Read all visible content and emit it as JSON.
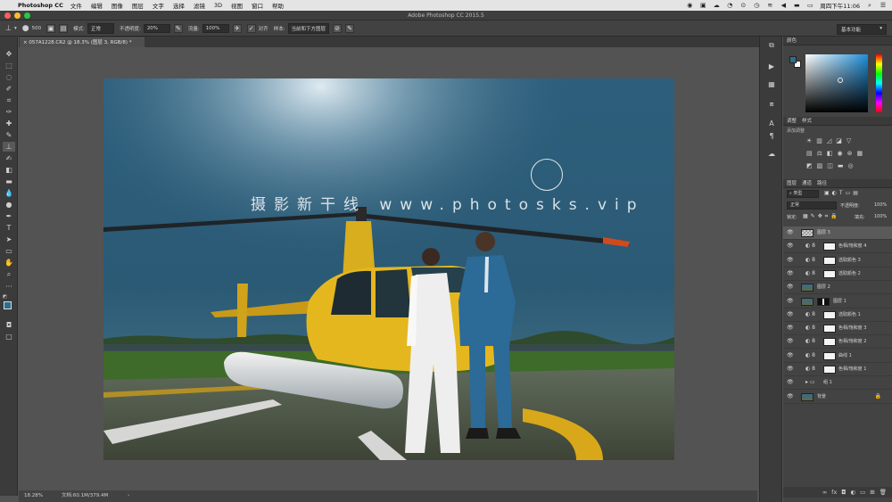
{
  "menubar": {
    "app": "Photoshop CC",
    "menus": [
      "文件",
      "编辑",
      "图像",
      "图层",
      "文字",
      "选择",
      "滤镜",
      "3D",
      "视图",
      "窗口",
      "帮助"
    ],
    "clock": "周四下午11:06"
  },
  "titlebar": {
    "title": "Adobe Photoshop CC 2015.5"
  },
  "options": {
    "brush_size": "500",
    "mode_label": "模式:",
    "mode_value": "正常",
    "opacity_label": "不透明度:",
    "opacity_value": "20%",
    "flow_label": "流量:",
    "flow_value": "100%",
    "aligned_label": "对齐",
    "sample_label": "样本:",
    "sample_value": "当前和下方图层",
    "workspace": "基本功能"
  },
  "document": {
    "tab_title": "057A1228.CR2 @ 18.3% (图层 3, RGB/8) *",
    "watermark": "摄影新干线 www.photosks.vip",
    "zoom": "18.28%",
    "doc_size": "文档:60.1M/379.4M"
  },
  "colors": {
    "foreground": "#2c6f8c",
    "background": "#ffffff"
  },
  "panels": {
    "color_title": "颜色",
    "adjust_tabs": [
      "调整",
      "样式"
    ],
    "adjust_hint": "添加调整",
    "layer_tabs": [
      "图层",
      "通道",
      "路径"
    ],
    "kind_label": "类型",
    "blend_mode": "正常",
    "opacity_label": "不透明度:",
    "opacity_value": "100%",
    "lock_label": "锁定:",
    "fill_label": "填充:",
    "fill_value": "100%"
  },
  "layers": [
    {
      "name": "图层 3",
      "selected": true,
      "type": "pixel"
    },
    {
      "name": "色相/饱和度 4",
      "type": "adj"
    },
    {
      "name": "选取颜色 3",
      "type": "adj"
    },
    {
      "name": "选取颜色 2",
      "type": "adj"
    },
    {
      "name": "图层 2",
      "type": "photo"
    },
    {
      "name": "图层 1",
      "type": "photo"
    },
    {
      "name": "选取颜色 1",
      "type": "adj"
    },
    {
      "name": "色相/饱和度 3",
      "type": "adj"
    },
    {
      "name": "色相/饱和度 2",
      "type": "adj"
    },
    {
      "name": "曲线 1",
      "type": "adj"
    },
    {
      "name": "色相/饱和度 1",
      "type": "adj"
    },
    {
      "name": "组 1",
      "type": "group"
    },
    {
      "name": "背景",
      "type": "background"
    }
  ]
}
